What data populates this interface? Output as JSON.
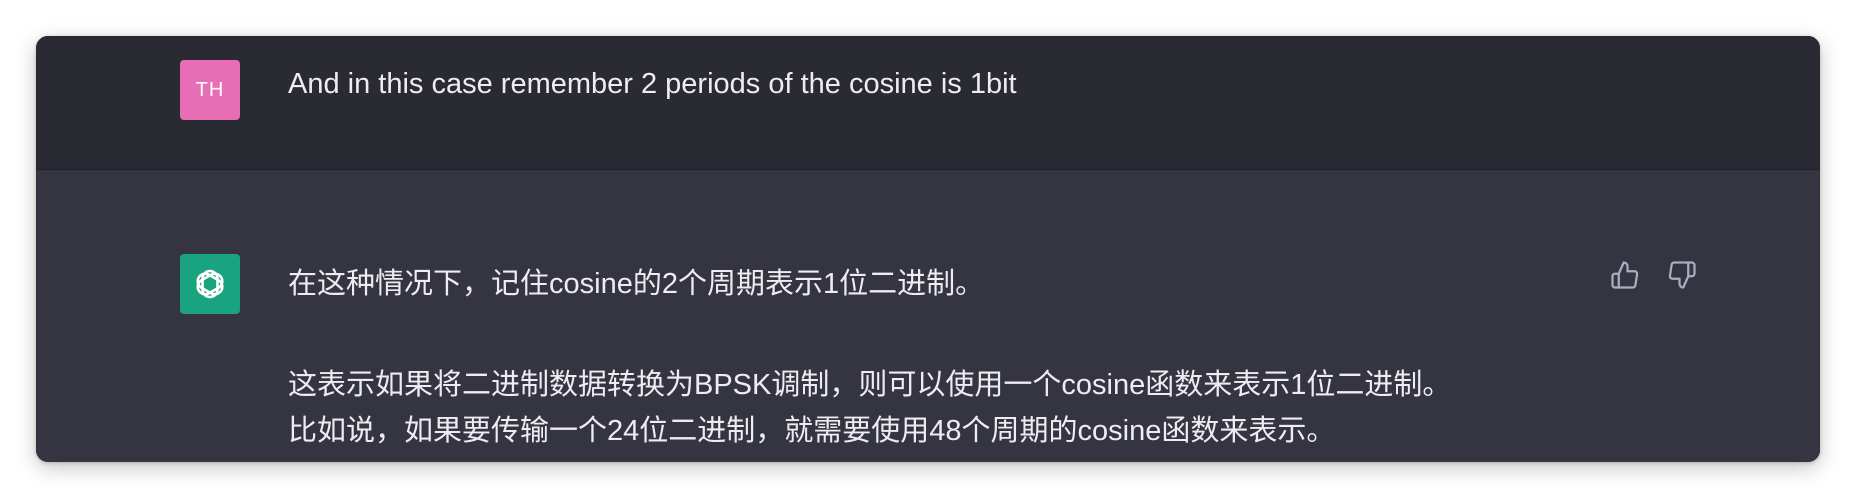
{
  "user_message": {
    "avatar_initials": "TH",
    "avatar_color": "#e76db4",
    "text": "And in this case remember 2 periods of the cosine is 1bit"
  },
  "assistant_message": {
    "avatar_icon": "openai-logo-icon",
    "avatar_color": "#19a37f",
    "paragraph_1": "在这种情况下，记住cosine的2个周期表示1位二进制。",
    "paragraph_2_line_1": "这表示如果将二进制数据转换为BPSK调制，则可以使用一个cosine函数来表示1位二进制。",
    "paragraph_2_line_2": "比如说，如果要传输一个24位二进制，就需要使用48个周期的cosine函数来表示。"
  },
  "actions": {
    "thumbs_up_icon": "thumbs-up-icon",
    "thumbs_down_icon": "thumbs-down-icon"
  },
  "colors": {
    "user_bg": "#2a2b32",
    "assistant_bg": "#343541",
    "text": "#ececf1",
    "icon": "#acacbe"
  }
}
